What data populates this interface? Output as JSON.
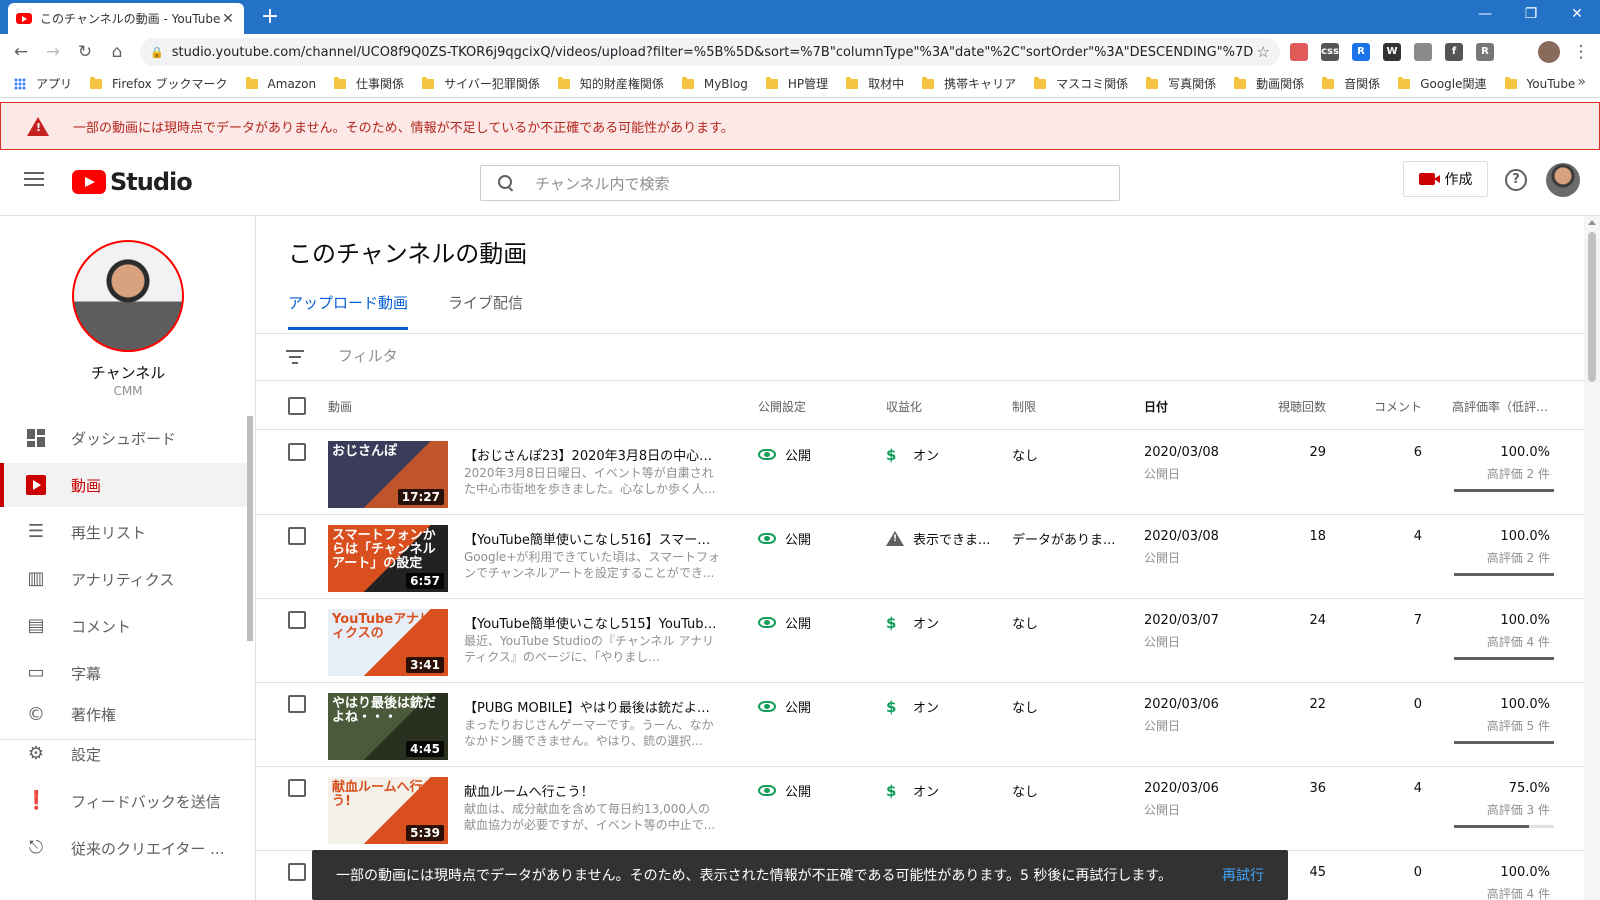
{
  "browser": {
    "tab_title": "このチャンネルの動画 - YouTube Studio",
    "new_tab": "+",
    "url": "studio.youtube.com/channel/UCO8f9Q0ZS-TKOR6j9qgcixQ/videos/upload?filter=%5B%5D&sort=%7B\"columnType\"%3A\"date\"%2C\"sortOrder\"%3A\"DESCENDING\"%7D",
    "bookmarks": [
      "アプリ",
      "Firefox ブックマーク",
      "Amazon",
      "仕事関係",
      "サイバー犯罪関係",
      "知的財産権関係",
      "MyBlog",
      "HP管理",
      "取材中",
      "携帯キャリア",
      "マスコミ関係",
      "写真関係",
      "動画関係",
      "音関係",
      "Google関連",
      "YouTube"
    ],
    "extensions": [
      {
        "label": "",
        "color": "#e05a5a"
      },
      {
        "label": "css",
        "color": "#555555"
      },
      {
        "label": "R",
        "color": "#1a73e8"
      },
      {
        "label": "W",
        "color": "#333333"
      },
      {
        "label": "",
        "color": "#8a8a8a"
      },
      {
        "label": "f",
        "color": "#555555"
      },
      {
        "label": "R",
        "color": "#777777"
      }
    ]
  },
  "warning_banner": "一部の動画には現時点でデータがありません。そのため、情報が不足しているか不正確である可能性があります。",
  "header": {
    "logo_text": "Studio",
    "search_placeholder": "チャンネル内で検索",
    "create_label": "作成",
    "help": "?"
  },
  "sidebar": {
    "channel_name": "チャンネル",
    "channel_sub": "CMM",
    "items": [
      {
        "label": "ダッシュボード",
        "icon": "dashboard-icon"
      },
      {
        "label": "動画",
        "icon": "video-icon",
        "active": true
      },
      {
        "label": "再生リスト",
        "icon": "playlist-icon"
      },
      {
        "label": "アナリティクス",
        "icon": "analytics-icon"
      },
      {
        "label": "コメント",
        "icon": "comment-icon"
      },
      {
        "label": "字幕",
        "icon": "subtitles-icon"
      },
      {
        "label": "著作権",
        "icon": "copyright-icon"
      }
    ],
    "bottom_items": [
      {
        "label": "設定",
        "icon": "gear-icon"
      },
      {
        "label": "フィードバックを送信",
        "icon": "feedback-icon"
      },
      {
        "label": "従来のクリエイター ...",
        "icon": "classic-studio-icon"
      }
    ]
  },
  "main": {
    "title": "このチャンネルの動画",
    "tabs": [
      "アップロード動画",
      "ライブ配信"
    ],
    "filter_placeholder": "フィルタ",
    "columns": [
      "動画",
      "公開設定",
      "収益化",
      "制限",
      "日付",
      "視聴回数",
      "コメント",
      "高評価率（低評価..."
    ],
    "rows": [
      {
        "title": "【おじさんぽ23】2020年3月8日の中心市...",
        "desc": "2020年3月8日日曜日、イベント等が自粛された中心市街地を歩きました。心なしか歩く人...",
        "thumb_text": "おじさんぽ",
        "thumb_colors": [
          "#3b3b5a",
          "#c0552a"
        ],
        "duration": "17:27",
        "visibility": "公開",
        "monetization": "オン",
        "monetization_icon": "dollar-icon",
        "restriction": "なし",
        "date": "2020/03/08",
        "date_sub": "公開日",
        "views": "29",
        "comments": "6",
        "like_pct": "100.0%",
        "like_sub": "高評価 2 件",
        "like_ratio": 1.0
      },
      {
        "title": "【YouTube簡単使いこなし516】スマート...",
        "desc": "Google+が利用できていた頃は、スマートフォンでチャンネルアートを設定することができ...",
        "thumb_text": "スマートフォンからは「チャンネルアート」の設定",
        "thumb_colors": [
          "#d94f1e",
          "#222222"
        ],
        "duration": "6:57",
        "visibility": "公開",
        "monetization": "表示できま...",
        "monetization_icon": "warning-icon",
        "restriction": "データがありま...",
        "date": "2020/03/08",
        "date_sub": "公開日",
        "views": "18",
        "comments": "4",
        "like_pct": "100.0%",
        "like_sub": "高評価 2 件",
        "like_ratio": 1.0
      },
      {
        "title": "【YouTube簡単使いこなし515】YouTube...",
        "desc": "最近、YouTube Studioの『チャンネル アナリティクス』のページに、「やりまし...",
        "thumb_text": "YouTubeアナリティクスの",
        "thumb_colors": [
          "#e8eef7",
          "#d94f1e"
        ],
        "duration": "3:41",
        "visibility": "公開",
        "monetization": "オン",
        "monetization_icon": "dollar-icon",
        "restriction": "なし",
        "date": "2020/03/07",
        "date_sub": "公開日",
        "views": "24",
        "comments": "7",
        "like_pct": "100.0%",
        "like_sub": "高評価 4 件",
        "like_ratio": 1.0
      },
      {
        "title": "【PUBG MOBILE】やはり最後は銃だよね...",
        "desc": "まったりおじさんゲーマーです。うーん、なかなかドン勝できません。やはり、銃の選択...",
        "thumb_text": "やはり最後は銃だよね・・・",
        "thumb_colors": [
          "#4a5a3a",
          "#2a3020"
        ],
        "duration": "4:45",
        "visibility": "公開",
        "monetization": "オン",
        "monetization_icon": "dollar-icon",
        "restriction": "なし",
        "date": "2020/03/06",
        "date_sub": "公開日",
        "views": "22",
        "comments": "0",
        "like_pct": "100.0%",
        "like_sub": "高評価 5 件",
        "like_ratio": 1.0
      },
      {
        "title": "献血ルームへ行こう！",
        "desc": "献血は、成分献血を含めて毎日約13,000人の献血協力が必要ですが、イベント等の中止で...",
        "thumb_text": "献血ルームへ行こう!",
        "thumb_colors": [
          "#f4f1ea",
          "#d94f1e"
        ],
        "duration": "5:39",
        "visibility": "公開",
        "monetization": "オン",
        "monetization_icon": "dollar-icon",
        "restriction": "なし",
        "date": "2020/03/06",
        "date_sub": "公開日",
        "views": "36",
        "comments": "4",
        "like_pct": "75.0%",
        "like_sub": "高評価 3 件",
        "like_ratio": 0.75
      },
      {
        "title": "",
        "desc": "",
        "thumb_text": "",
        "thumb_colors": [
          "#ffffff",
          "#ffffff"
        ],
        "duration": "",
        "visibility": "",
        "monetization": "",
        "monetization_icon": "",
        "restriction": "",
        "date": "",
        "date_sub": "",
        "views": "45",
        "comments": "0",
        "like_pct": "100.0%",
        "like_sub": "高評価 4 件",
        "like_ratio": 1.0
      }
    ]
  },
  "snackbar": {
    "message": "一部の動画には現時点でデータがありません。そのため、表示された情報が不正確である可能性があります。5 秒後に再試行します。",
    "action": "再試行"
  }
}
